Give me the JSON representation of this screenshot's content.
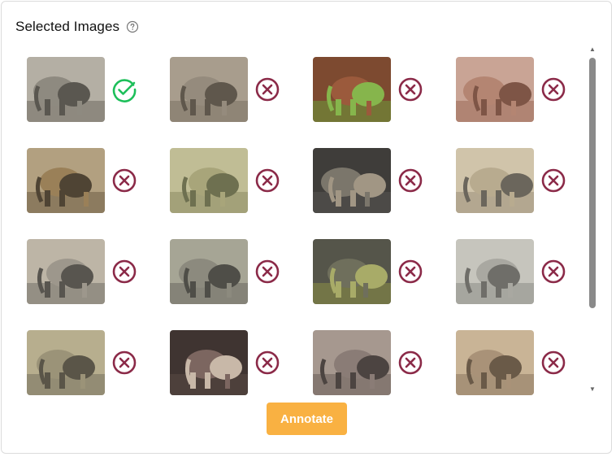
{
  "panel": {
    "title": "Selected Images",
    "help_icon": "question-circle-icon"
  },
  "colors": {
    "selected": "#1dbf5a",
    "rejected": "#8b2a48",
    "annotate_button": "#f9b142"
  },
  "images": [
    {
      "status": "selected",
      "icon": "check-circle-icon"
    },
    {
      "status": "rejected",
      "icon": "x-circle-icon"
    },
    {
      "status": "rejected",
      "icon": "x-circle-icon"
    },
    {
      "status": "rejected",
      "icon": "x-circle-icon"
    },
    {
      "status": "rejected",
      "icon": "x-circle-icon"
    },
    {
      "status": "rejected",
      "icon": "x-circle-icon"
    },
    {
      "status": "rejected",
      "icon": "x-circle-icon"
    },
    {
      "status": "rejected",
      "icon": "x-circle-icon"
    },
    {
      "status": "rejected",
      "icon": "x-circle-icon"
    },
    {
      "status": "rejected",
      "icon": "x-circle-icon"
    },
    {
      "status": "rejected",
      "icon": "x-circle-icon"
    },
    {
      "status": "rejected",
      "icon": "x-circle-icon"
    },
    {
      "status": "rejected",
      "icon": "x-circle-icon"
    },
    {
      "status": "rejected",
      "icon": "x-circle-icon"
    },
    {
      "status": "rejected",
      "icon": "x-circle-icon"
    },
    {
      "status": "rejected",
      "icon": "x-circle-icon"
    }
  ],
  "actions": {
    "annotate_label": "Annotate"
  }
}
